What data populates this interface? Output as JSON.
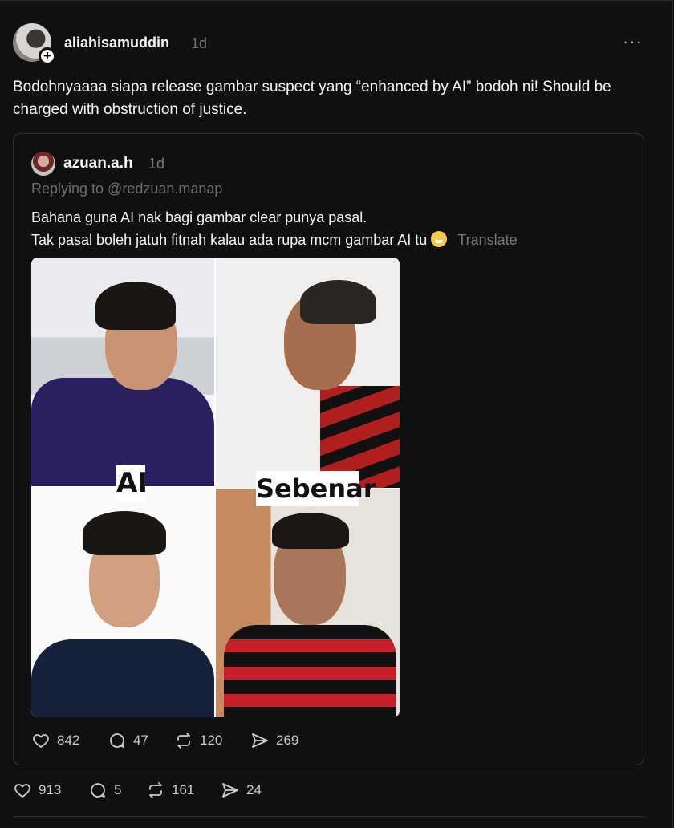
{
  "post": {
    "username": "aliahisamuddin",
    "time": "1d",
    "more": "···",
    "text": "Bodohnyaaaa siapa release gambar suspect yang “enhanced by AI” bodoh ni! Should be charged with obstruction of justice.",
    "actions": {
      "likes": "913",
      "replies": "5",
      "reposts": "161",
      "shares": "24"
    }
  },
  "quote": {
    "username": "azuan.a.h",
    "time": "1d",
    "replying": "Replying to @redzuan.manap",
    "line1": "Bahana guna AI nak bagi gambar clear punya pasal.",
    "line2": "Tak pasal boleh jatuh fitnah kalau ada rupa mcm gambar AI tu",
    "translate": "Translate",
    "image": {
      "label_left": "AI",
      "label_right": "Sebenar"
    },
    "actions": {
      "likes": "842",
      "replies": "47",
      "reposts": "120",
      "shares": "269"
    }
  },
  "icons": {
    "like": "heart-icon",
    "reply": "comment-icon",
    "repost": "repost-icon",
    "share": "send-icon",
    "more": "more-icon",
    "follow": "plus-icon",
    "emoji": "grinning-sweat-emoji"
  }
}
